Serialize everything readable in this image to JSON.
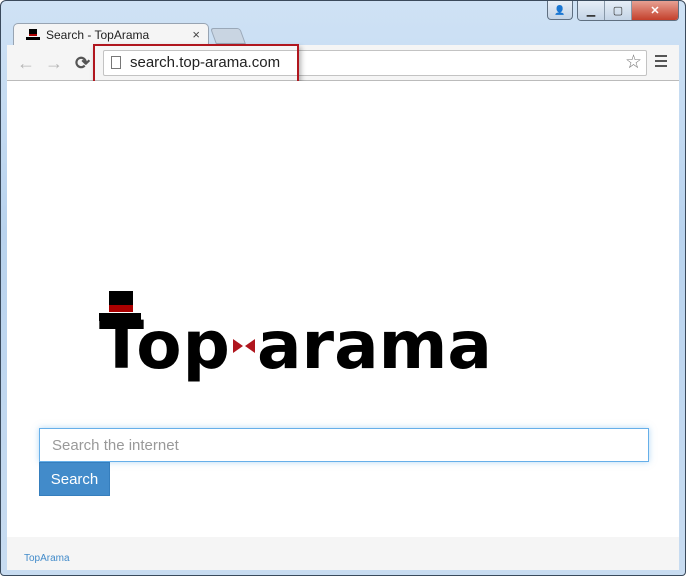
{
  "browser": {
    "tab": {
      "title": "Search - TopArama",
      "close": "×"
    },
    "address": {
      "url": "search.top-arama.com"
    },
    "nav": {
      "back": "←",
      "forward": "→",
      "reload": "⟳"
    },
    "star": "☆",
    "window_controls": {
      "user": "👤",
      "minimize": "▁",
      "maximize": "▢",
      "close": "✕"
    }
  },
  "page": {
    "logo": {
      "word1": "Top",
      "word2": "arama"
    },
    "search": {
      "placeholder": "Search the internet",
      "value": "",
      "button_label": "Search"
    },
    "footer": {
      "link": "TopArama"
    }
  }
}
